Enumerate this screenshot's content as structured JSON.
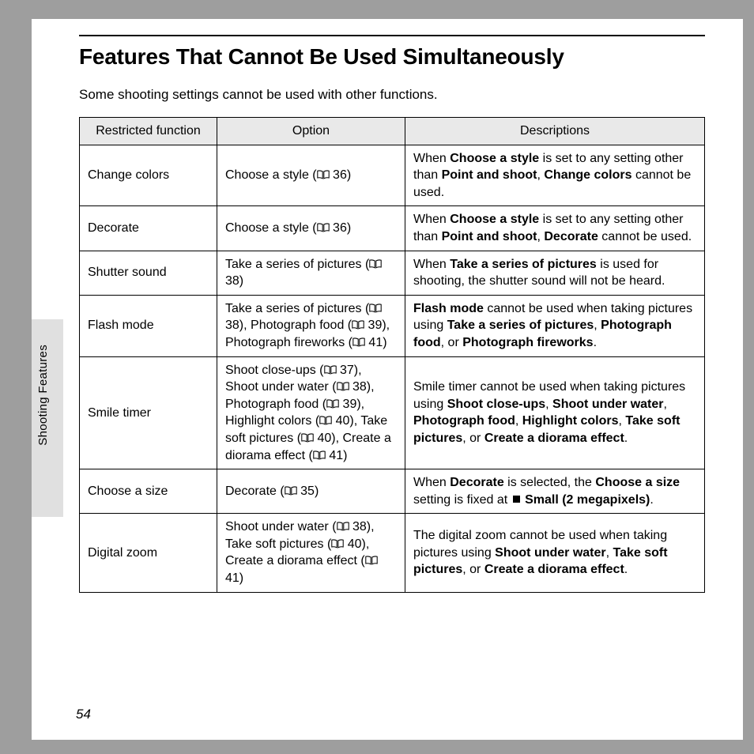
{
  "page": {
    "title": "Features That Cannot Be Used Simultaneously",
    "intro": "Some shooting settings cannot be used with other functions.",
    "number": "54",
    "section_tab": "Shooting Features"
  },
  "table": {
    "headers": {
      "c1": "Restricted function",
      "c2": "Option",
      "c3": "Descriptions"
    },
    "rows": [
      {
        "fn": "Change colors",
        "opt": [
          {
            "t": "Choose a style ("
          },
          {
            "icon": true
          },
          {
            "t": " 36)"
          }
        ],
        "desc": [
          {
            "t": "When "
          },
          {
            "b": "Choose a style"
          },
          {
            "t": " is set to any setting other than "
          },
          {
            "b": "Point and shoot"
          },
          {
            "t": ", "
          },
          {
            "b": "Change colors"
          },
          {
            "t": " cannot be used."
          }
        ]
      },
      {
        "fn": "Decorate",
        "opt": [
          {
            "t": "Choose a style ("
          },
          {
            "icon": true
          },
          {
            "t": " 36)"
          }
        ],
        "desc": [
          {
            "t": "When "
          },
          {
            "b": "Choose a style"
          },
          {
            "t": " is set to any setting other than "
          },
          {
            "b": "Point and shoot"
          },
          {
            "t": ", "
          },
          {
            "b": "Decorate"
          },
          {
            "t": " cannot be used."
          }
        ]
      },
      {
        "fn": "Shutter sound",
        "opt": [
          {
            "t": "Take a series of pictures ("
          },
          {
            "icon": true
          },
          {
            "t": " 38)"
          }
        ],
        "desc": [
          {
            "t": "When "
          },
          {
            "b": "Take a series of pictures"
          },
          {
            "t": " is used for shooting, the shutter sound will not be heard."
          }
        ]
      },
      {
        "fn": "Flash mode",
        "opt": [
          {
            "t": "Take a series of pictures ("
          },
          {
            "icon": true
          },
          {
            "t": " 38), Photograph food ("
          },
          {
            "icon": true
          },
          {
            "t": " 39), Photograph fireworks ("
          },
          {
            "icon": true
          },
          {
            "t": " 41)"
          }
        ],
        "desc": [
          {
            "b": "Flash mode"
          },
          {
            "t": " cannot be used when taking pictures using "
          },
          {
            "b": "Take a series of pictures"
          },
          {
            "t": ", "
          },
          {
            "b": "Photograph food"
          },
          {
            "t": ", or "
          },
          {
            "b": "Photograph fireworks"
          },
          {
            "t": "."
          }
        ]
      },
      {
        "fn": "Smile timer",
        "opt": [
          {
            "t": "Shoot close-ups ("
          },
          {
            "icon": true
          },
          {
            "t": " 37), Shoot under water ("
          },
          {
            "icon": true
          },
          {
            "t": " 38), Photograph food ("
          },
          {
            "icon": true
          },
          {
            "t": " 39), Highlight colors ("
          },
          {
            "icon": true
          },
          {
            "t": " 40), Take soft pictures ("
          },
          {
            "icon": true
          },
          {
            "t": " 40), Create a diorama effect ("
          },
          {
            "icon": true
          },
          {
            "t": " 41)"
          }
        ],
        "desc": [
          {
            "t": "Smile timer cannot be used when taking pictures using "
          },
          {
            "b": "Shoot close-ups"
          },
          {
            "t": ", "
          },
          {
            "b": "Shoot under water"
          },
          {
            "t": ", "
          },
          {
            "b": "Photograph food"
          },
          {
            "t": ", "
          },
          {
            "b": "Highlight colors"
          },
          {
            "t": ", "
          },
          {
            "b": "Take soft pictures"
          },
          {
            "t": ", or "
          },
          {
            "b": "Create a diorama effect"
          },
          {
            "t": "."
          }
        ]
      },
      {
        "fn": "Choose a size",
        "opt": [
          {
            "t": "Decorate ("
          },
          {
            "icon": true
          },
          {
            "t": " 35)"
          }
        ],
        "desc": [
          {
            "t": "When "
          },
          {
            "b": "Decorate"
          },
          {
            "t": " is selected, the "
          },
          {
            "b": "Choose a size"
          },
          {
            "t": " setting is fixed at "
          },
          {
            "sq": true
          },
          {
            "b": "Small (2 megapixels)"
          },
          {
            "t": "."
          }
        ]
      },
      {
        "fn": "Digital zoom",
        "opt": [
          {
            "t": "Shoot under water ("
          },
          {
            "icon": true
          },
          {
            "t": " 38), Take soft pictures ("
          },
          {
            "icon": true
          },
          {
            "t": " 40), Create a diorama effect ("
          },
          {
            "icon": true
          },
          {
            "t": " 41)"
          }
        ],
        "desc": [
          {
            "t": "The digital zoom cannot be used when taking pictures using "
          },
          {
            "b": "Shoot under water"
          },
          {
            "t": ", "
          },
          {
            "b": "Take soft pictures"
          },
          {
            "t": ", or "
          },
          {
            "b": "Create a diorama effect"
          },
          {
            "t": "."
          }
        ]
      }
    ]
  }
}
